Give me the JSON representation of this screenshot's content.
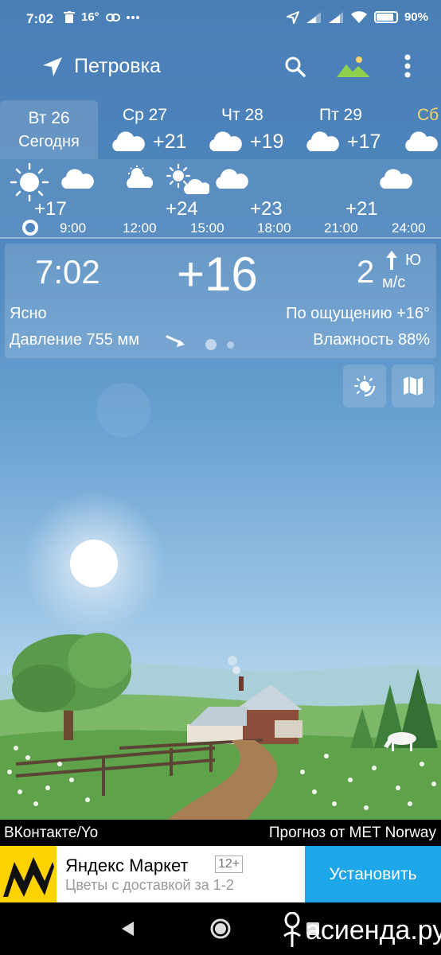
{
  "status_bar": {
    "time": "7:02",
    "temp_indicator": "16°",
    "battery": "90%",
    "battery_level": 0.9,
    "icons": [
      "trash-icon",
      "link-icon",
      "more-icon",
      "location-arrow-icon",
      "signal-icon",
      "signal-icon",
      "wifi-icon",
      "battery-icon"
    ]
  },
  "header": {
    "location": "Петровка",
    "icons": [
      "location-arrow-icon",
      "search-icon",
      "landscape-icon",
      "menu-icon"
    ]
  },
  "days": [
    {
      "name": "Вт 26",
      "sub": "Сегодня",
      "selected": true
    },
    {
      "name": "Ср 27",
      "temp": "+21",
      "icon": "cloud-icon"
    },
    {
      "name": "Чт 28",
      "temp": "+19",
      "icon": "cloud-icon"
    },
    {
      "name": "Пт 29",
      "temp": "+17",
      "icon": "cloud-icon"
    },
    {
      "name": "Сб",
      "icon": "cloud-icon",
      "color": "#f5d56b"
    }
  ],
  "hourly": {
    "temps": [
      "+17",
      "+24",
      "+23",
      "+21"
    ],
    "times": [
      "9:00",
      "12:00",
      "15:00",
      "18:00",
      "21:00",
      "24:00"
    ],
    "icons": [
      "sun-icon",
      "cloud-icon",
      "partly-sunny-icon",
      "partly-cloudy-icon",
      "cloud-icon",
      "cloud-icon"
    ]
  },
  "current": {
    "time": "7:02",
    "temp": "+16",
    "wind_speed": "2",
    "wind_dir": "Ю",
    "wind_unit": "м/с",
    "condition": "Ясно",
    "feels": "По ощущению +16°",
    "pressure": "Давление 755 мм",
    "humidity": "Влажность 88%"
  },
  "footer": {
    "credit_left": "ВКонтакте/Yo",
    "credit_right": "Прогноз от MET Norway"
  },
  "ad": {
    "title": "Яндекс Маркет",
    "badge": "12+",
    "subtitle": "Цветы с доставкой за 1-2",
    "button": "Установить"
  },
  "watermark": "асиенда.ру",
  "colors": {
    "accent_yellow": "#f5d56b",
    "install_blue": "#1ea7e8",
    "ad_logo_yellow": "#ffd300"
  }
}
